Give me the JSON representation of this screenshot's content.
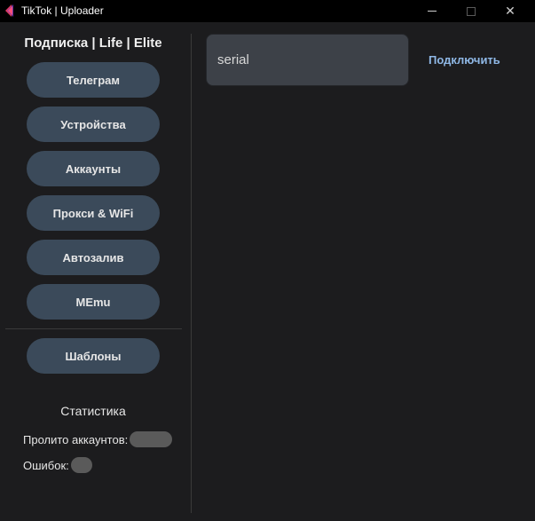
{
  "window": {
    "title": "TikTok | Uploader",
    "controls": {
      "minimize": "—",
      "maximize": "☐",
      "close": "✕"
    }
  },
  "sidebar": {
    "title": "Подписка | Life | Elite",
    "nav": [
      {
        "label": "Телеграм"
      },
      {
        "label": "Устройства"
      },
      {
        "label": "Аккаунты"
      },
      {
        "label": "Прокси & WiFi"
      },
      {
        "label": "Автозалив"
      },
      {
        "label": "MEmu"
      }
    ],
    "templates_label": "Шаблоны"
  },
  "stats": {
    "title": "Статистика",
    "accounts_label": "Пролито аккаунтов:",
    "errors_label": "Ошибок:"
  },
  "main": {
    "serial_placeholder": "serial",
    "connect_label": "Подключить"
  },
  "colors": {
    "background": "#1c1c1e",
    "titlebar": "#000000",
    "button": "#3b4a5a",
    "input": "#3d4148",
    "link": "#8fb8e6"
  },
  "icons": [
    "tiktok-logo-icon",
    "minimize-icon",
    "maximize-icon",
    "close-icon"
  ]
}
